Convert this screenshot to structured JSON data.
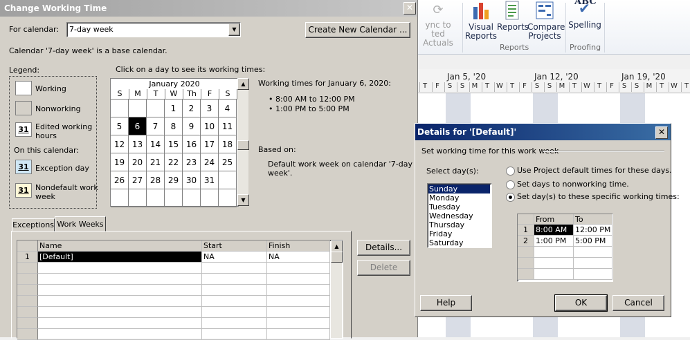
{
  "main_dialog": {
    "title": "Change Working Time",
    "for_calendar_label": "For calendar:",
    "calendar_value": "7-day week",
    "create_button": "Create New Calendar ...",
    "base_calendar_text": "Calendar '7-day week' is a base calendar.",
    "legend_label": "Legend:",
    "legend": {
      "working": "Working",
      "nonworking": "Nonworking",
      "edited_line1": "Edited working",
      "edited_line2": "hours",
      "on_this_calendar": "On this calendar:",
      "exception": "Exception day",
      "nondefault_line1": "Nondefault work",
      "nondefault_line2": "week",
      "sample_day": "31"
    },
    "click_instruction": "Click on a day to see its working times:",
    "calendar": {
      "month": "January 2020",
      "weekdays": [
        "S",
        "M",
        "T",
        "W",
        "Th",
        "F",
        "S"
      ],
      "weeks": [
        [
          "",
          "",
          "",
          "1",
          "2",
          "3",
          "4"
        ],
        [
          "5",
          "6",
          "7",
          "8",
          "9",
          "10",
          "11"
        ],
        [
          "12",
          "13",
          "14",
          "15",
          "16",
          "17",
          "18"
        ],
        [
          "19",
          "20",
          "21",
          "22",
          "23",
          "24",
          "25"
        ],
        [
          "26",
          "27",
          "28",
          "29",
          "30",
          "31",
          ""
        ],
        [
          "",
          "",
          "",
          "",
          "",
          "",
          ""
        ]
      ],
      "selected": "6"
    },
    "working_times_title": "Working times for January 6, 2020:",
    "working_times": [
      "8:00 AM to 12:00 PM",
      "1:00 PM to 5:00 PM"
    ],
    "based_on_label": "Based on:",
    "based_on_text_line1": "Default work week on calendar '7-day",
    "based_on_text_line2": "week'.",
    "tabs": [
      "Exceptions",
      "Work Weeks"
    ],
    "active_tab": "Work Weeks",
    "table": {
      "headers": [
        "Name",
        "Start",
        "Finish"
      ],
      "rows": [
        {
          "num": "1",
          "name": "[Default]",
          "start": "NA",
          "finish": "NA"
        }
      ]
    },
    "details_button": "Details...",
    "delete_button": "Delete"
  },
  "ribbon": {
    "sync_line1": "ync to",
    "sync_line2": "ted Actuals",
    "visual_reports_line1": "Visual",
    "visual_reports_line2": "Reports",
    "reports": "Reports",
    "compare_line1": "Compare",
    "compare_line2": "Projects",
    "spelling": "Spelling",
    "abc": "ABC",
    "group_reports": "Reports",
    "group_proofing": "Proofing"
  },
  "gantt": {
    "weeks": [
      "Jan 5, '20",
      "Jan 12, '20",
      "Jan 19, '20"
    ],
    "days": [
      "T",
      "F",
      "S",
      "S",
      "M",
      "T",
      "W",
      "T",
      "F",
      "S",
      "S",
      "M",
      "T",
      "W",
      "T",
      "F",
      "S",
      "S",
      "M",
      "T",
      "W",
      "T",
      "F"
    ]
  },
  "details_dialog": {
    "title": "Details for '[Default]'",
    "subtitle": "Set working time for this work week",
    "select_days_label": "Select day(s):",
    "days": [
      "Sunday",
      "Monday",
      "Tuesday",
      "Wednesday",
      "Thursday",
      "Friday",
      "Saturday"
    ],
    "selected_day": "Sunday",
    "options": [
      "Use Project default times for these days.",
      "Set days to nonworking time.",
      "Set day(s) to these specific working times:"
    ],
    "selected_option": 2,
    "times_headers": [
      "From",
      "To"
    ],
    "times": [
      {
        "num": "1",
        "from": "8:00 AM",
        "to": "12:00 PM"
      },
      {
        "num": "2",
        "from": "1:00 PM",
        "to": "5:00 PM"
      }
    ],
    "help_button": "Help",
    "ok_button": "OK",
    "cancel_button": "Cancel"
  },
  "colors": {
    "dialog_bg": "#d4d0c8",
    "title_active": "#0a246a",
    "title_inactive": "#a0a0a0",
    "selection": "#0a246a",
    "exception_fill": "#cfe7f5"
  }
}
